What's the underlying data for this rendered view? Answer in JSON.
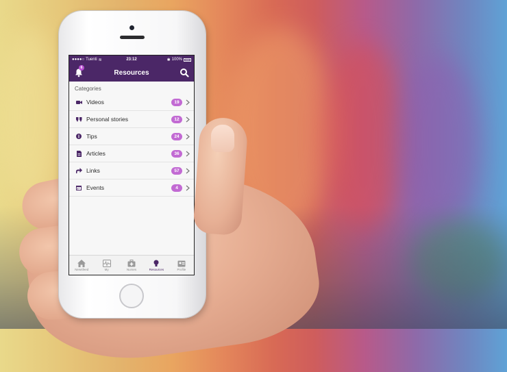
{
  "theme": {
    "primary": "#4b2767",
    "badge": "#c26ad3",
    "bell_badge": "#b84fd1"
  },
  "statusbar": {
    "carrier": "Tuenti",
    "time": "23:12",
    "battery": "100%"
  },
  "navbar": {
    "title": "Resources",
    "notification_count": "6",
    "left_icon": "bell-icon",
    "right_icon": "search-icon"
  },
  "categories": {
    "header": "Categories",
    "items": [
      {
        "label": "Videos",
        "count": "19",
        "icon": "video-camera-icon"
      },
      {
        "label": "Personal stories",
        "count": "12",
        "icon": "quote-icon"
      },
      {
        "label": "Tips",
        "count": "24",
        "icon": "info-icon"
      },
      {
        "label": "Articles",
        "count": "36",
        "icon": "document-icon"
      },
      {
        "label": "Links",
        "count": "57",
        "icon": "share-arrow-icon"
      },
      {
        "label": "Events",
        "count": "4",
        "icon": "calendar-icon"
      }
    ]
  },
  "tabbar": {
    "items": [
      {
        "label": "Newsfeed",
        "icon": "home-icon"
      },
      {
        "label": "My",
        "icon": "heartbeat-icon"
      },
      {
        "label": "Nurses",
        "icon": "medical-kit-icon"
      },
      {
        "label": "Resources",
        "icon": "lightbulb-icon",
        "active": true
      },
      {
        "label": "Profile",
        "icon": "profile-card-icon"
      }
    ]
  }
}
